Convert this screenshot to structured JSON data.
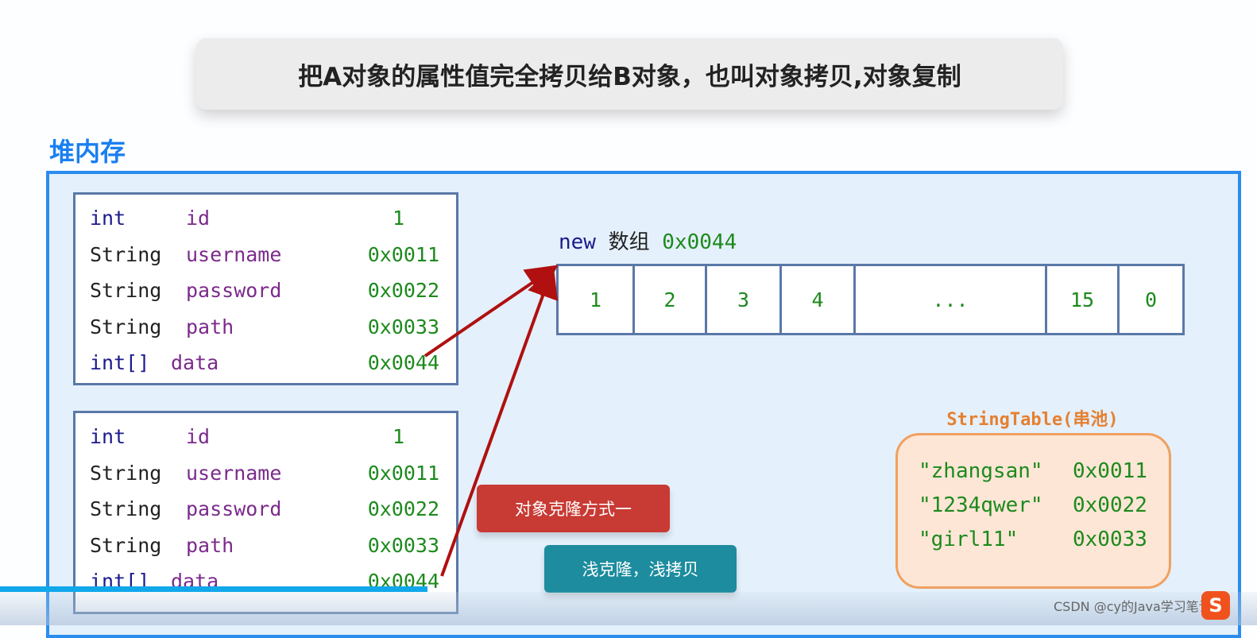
{
  "title": "把A对象的属性值完全拷贝给B对象，也叫对象拷贝,对象复制",
  "heap_label": "堆内存",
  "objects": [
    {
      "rows": [
        {
          "type": "int",
          "name": "id",
          "value": "1"
        },
        {
          "type": "String",
          "name": "username",
          "value": "0x0011"
        },
        {
          "type": "String",
          "name": "password",
          "value": "0x0022"
        },
        {
          "type": "String",
          "name": "path",
          "value": "0x0033"
        },
        {
          "type": "int[]",
          "name": "data",
          "value": "0x0044"
        }
      ]
    },
    {
      "rows": [
        {
          "type": "int",
          "name": "id",
          "value": "1"
        },
        {
          "type": "String",
          "name": "username",
          "value": "0x0011"
        },
        {
          "type": "String",
          "name": "password",
          "value": "0x0022"
        },
        {
          "type": "String",
          "name": "path",
          "value": "0x0033"
        },
        {
          "type": "int[]",
          "name": "data",
          "value": "0x0044"
        }
      ]
    }
  ],
  "array": {
    "new": "new",
    "label": "数组",
    "address": "0x0044",
    "cells": [
      "1",
      "2",
      "3",
      "4",
      "...",
      "15",
      "0"
    ]
  },
  "string_table": {
    "label": "StringTable(串池)",
    "entries": [
      {
        "value": "\"zhangsan\"",
        "address": "0x0011"
      },
      {
        "value": "\"1234qwer\"",
        "address": "0x0022"
      },
      {
        "value": "\"girl11\"",
        "address": "0x0033"
      }
    ]
  },
  "buttons": {
    "clone_method": "对象克隆方式一",
    "shallow": "浅克隆，浅拷贝"
  },
  "watermark": "CSDN @cy的Java学习笔记",
  "colors": {
    "heap_border": "#2a8cf0",
    "arrow": "#b01010",
    "string_table": "#f0a060",
    "button_red": "#c83a34",
    "button_teal": "#1c8c9e"
  },
  "video_progress_percent": 34
}
